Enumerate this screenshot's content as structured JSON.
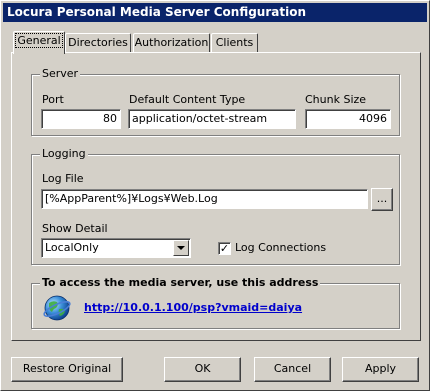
{
  "window": {
    "title": "Locura Personal Media Server Configuration"
  },
  "tabs": [
    {
      "label": "General",
      "selected": true
    },
    {
      "label": "Directories"
    },
    {
      "label": "Authorization"
    },
    {
      "label": "Clients"
    }
  ],
  "server": {
    "group_label": "Server",
    "port_label": "Port",
    "port_value": "80",
    "content_type_label": "Default Content Type",
    "content_type_value": "application/octet-stream",
    "chunk_size_label": "Chunk Size",
    "chunk_size_value": "4096"
  },
  "logging": {
    "group_label": "Logging",
    "log_file_label": "Log File",
    "log_file_value": "[%AppParent%]¥Logs¥Web.Log",
    "browse_label": "...",
    "show_detail_label": "Show Detail",
    "show_detail_value": "LocalOnly",
    "log_connections_label": "Log Connections",
    "log_connections_checked": true
  },
  "access": {
    "group_label": "To access the media server, use this address",
    "url": "http://10.0.1.100/psp?vmaid=daiya",
    "icon": "globe-icon"
  },
  "buttons": {
    "restore": "Restore Original",
    "ok": "OK",
    "cancel": "Cancel",
    "apply": "Apply"
  }
}
